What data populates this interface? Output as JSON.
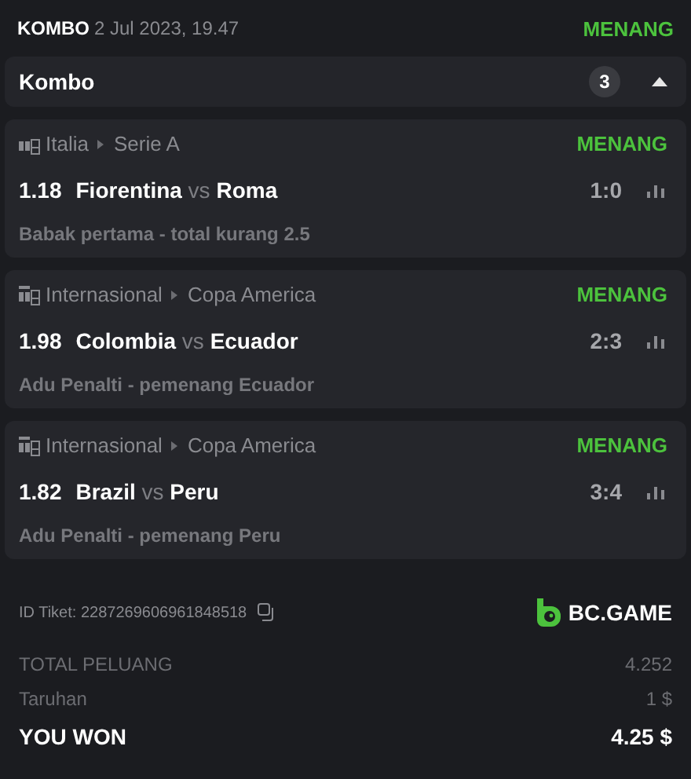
{
  "header": {
    "type": "KOMBO",
    "date": "2 Jul 2023, 19.47",
    "status": "MENANG",
    "won": true
  },
  "group": {
    "title": "Kombo",
    "count": "3",
    "expanded": true
  },
  "legs": [
    {
      "country": "Italia",
      "league": "Serie A",
      "status": "MENANG",
      "won": true,
      "odds": "1.18",
      "home": "Fiorentina",
      "vs": "vs",
      "away": "Roma",
      "score": "1:0",
      "market": "Babak pertama - total kurang 2.5"
    },
    {
      "country": "Internasional",
      "league": "Copa America",
      "status": "MENANG",
      "won": true,
      "odds": "1.98",
      "home": "Colombia",
      "vs": "vs",
      "away": "Ecuador",
      "score": "2:3",
      "market": "Adu Penalti - pemenang Ecuador"
    },
    {
      "country": "Internasional",
      "league": "Copa America",
      "status": "MENANG",
      "won": true,
      "odds": "1.82",
      "home": "Brazil",
      "vs": "vs",
      "away": "Peru",
      "score": "3:4",
      "market": "Adu Penalti - pemenang Peru"
    }
  ],
  "ticket": {
    "label": "ID Tiket: 2287269606961848518",
    "brand": "BC.GAME"
  },
  "totals": [
    {
      "kind": "plain",
      "label": "TOTAL PELUANG",
      "value": "4.252"
    },
    {
      "kind": "plain",
      "label": "Taruhan",
      "value": "1 $"
    },
    {
      "kind": "strong",
      "label": "YOU WON",
      "value": "4.25 $"
    }
  ]
}
